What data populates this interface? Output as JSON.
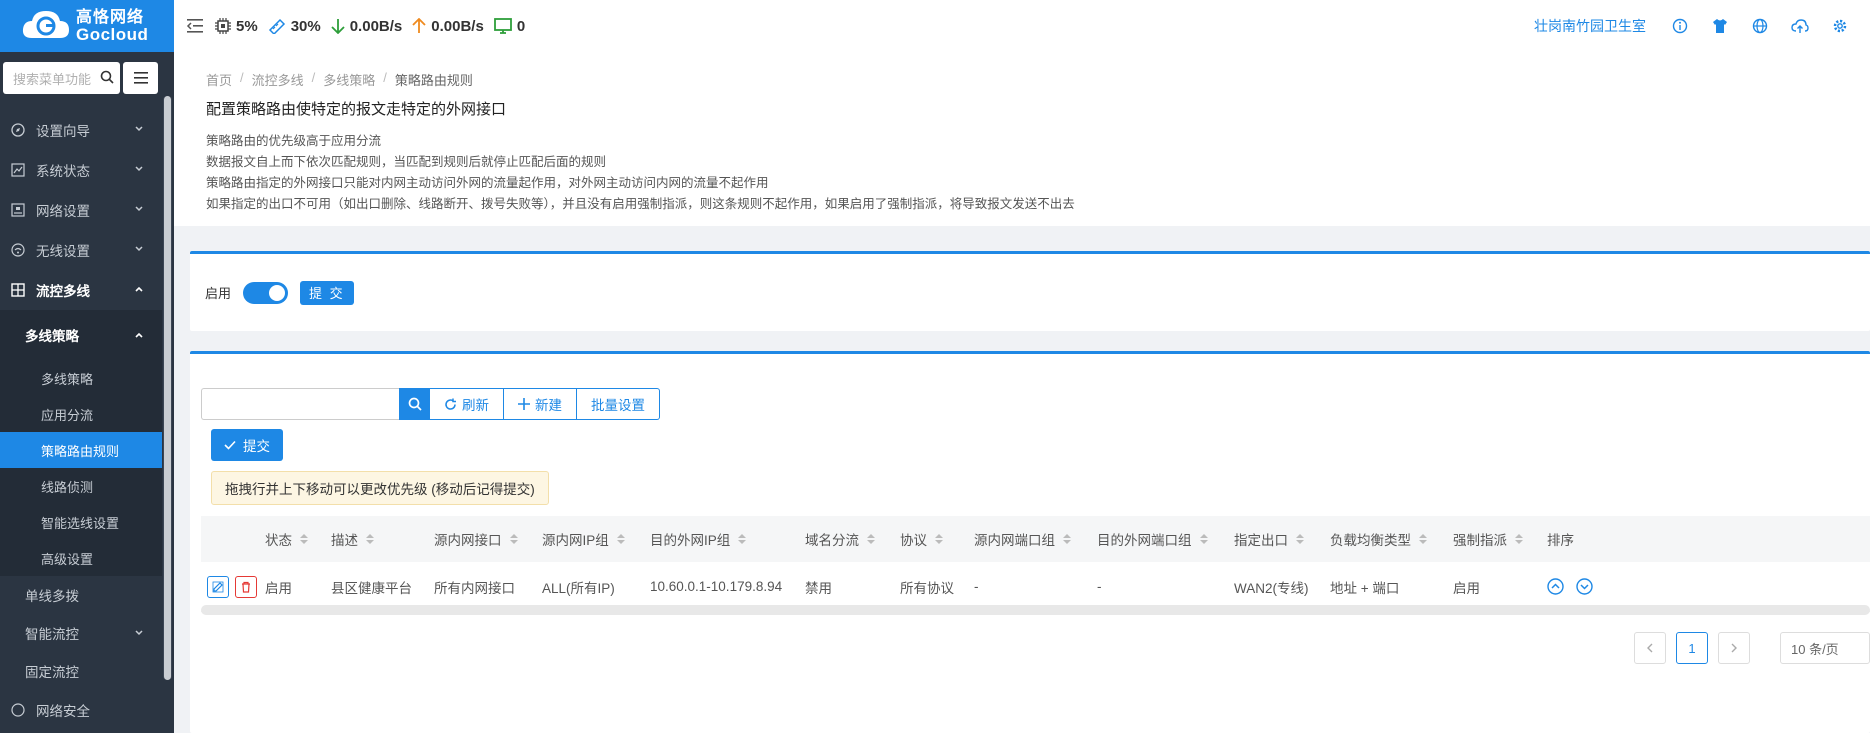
{
  "brand": {
    "cn": "高恪网络",
    "en": "Gocloud",
    "color": "#1e88e5"
  },
  "sidebar": {
    "search_placeholder": "搜索菜单功能",
    "items": [
      {
        "label": "设置向导",
        "icon": "compass-icon"
      },
      {
        "label": "系统状态",
        "icon": "chart-icon"
      },
      {
        "label": "网络设置",
        "icon": "network-icon"
      },
      {
        "label": "无线设置",
        "icon": "wifi-icon"
      },
      {
        "label": "流控多线",
        "icon": "grid-icon"
      }
    ],
    "sub_head": "多线策略",
    "sub_items": [
      "多线策略",
      "应用分流",
      "策略路由规则",
      "线路侦测",
      "智能选线设置",
      "高级设置"
    ],
    "lvl2": [
      "单线多拨",
      "智能流控",
      "固定流控"
    ],
    "last_item": "网络安全"
  },
  "topbar": {
    "cpu": "5%",
    "mem": "30%",
    "down": "0.00B/s",
    "up": "0.00B/s",
    "terminals": "0",
    "location": "壮岗南竹园卫生室"
  },
  "breadcrumb": [
    "首页",
    "流控多线",
    "多线策略",
    "策略路由规则"
  ],
  "page_title": "配置策略路由使特定的报文走特定的外网接口",
  "desc": [
    "策略路由的优先级高于应用分流",
    "数据报文自上而下依次匹配规则，当匹配到规则后就停止匹配后面的规则",
    "策略路由指定的外网接口只能对内网主动访问外网的流量起作用，对外网主动访问内网的流量不起作用",
    "如果指定的出口不可用（如出口删除、线路断开、拨号失败等），并且没有启用强制指派，则这条规则不起作用，如果启用了强制指派，将导致报文发送不出去"
  ],
  "enable_label": "启用",
  "submit_label": "提 交",
  "toolbar": {
    "refresh": "刷新",
    "new": "新建",
    "batch": "批量设置",
    "submit": "提交"
  },
  "tip": "拖拽行并上下移动可以更改优先级 (移动后记得提交)",
  "table": {
    "headers": [
      "状态",
      "描述",
      "源内网接口",
      "源内网IP组",
      "目的外网IP组",
      "域名分流",
      "协议",
      "源内网端口组",
      "目的外网端口组",
      "指定出口",
      "负载均衡类型",
      "强制指派",
      "排序"
    ],
    "rows": [
      [
        "启用",
        "县区健康平台",
        "所有内网接口",
        "ALL(所有IP)",
        "10.60.0.1-10.179.8.94",
        "禁用",
        "所有协议",
        "-",
        "-",
        "WAN2(专线)",
        "地址 + 端口",
        "启用"
      ]
    ]
  },
  "pager": {
    "page": "1",
    "size": "10 条/页"
  }
}
